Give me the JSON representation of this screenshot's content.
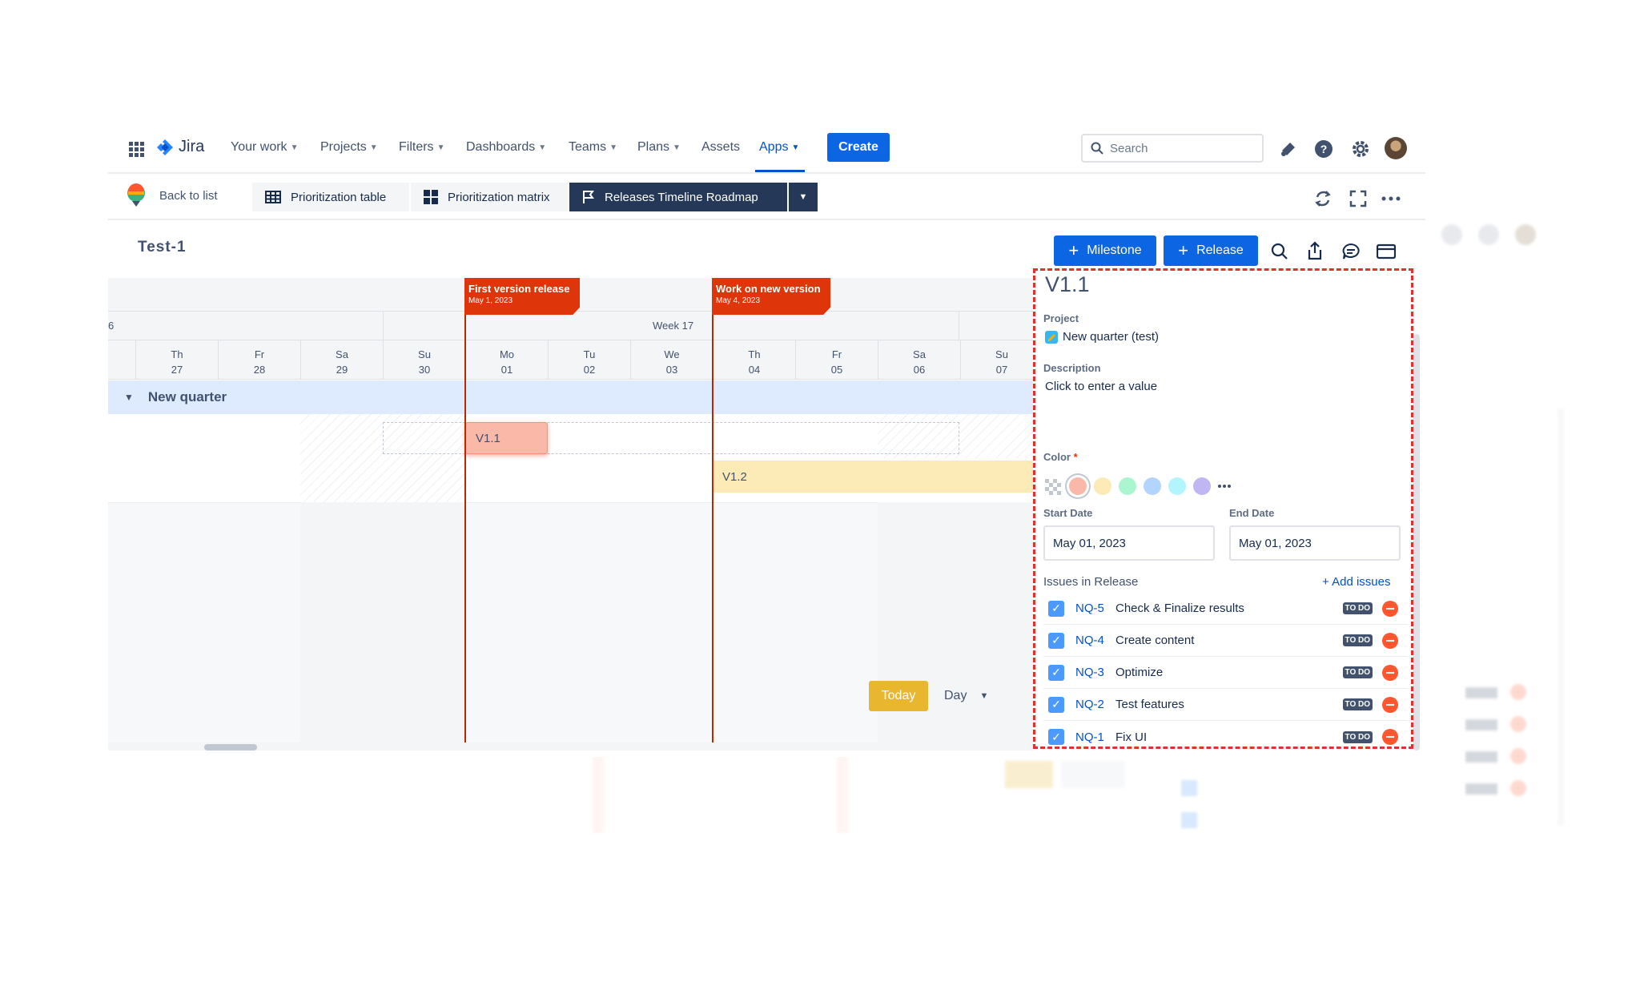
{
  "topnav": {
    "logo": "Jira",
    "items": [
      "Your work",
      "Projects",
      "Filters",
      "Dashboards",
      "Teams",
      "Plans",
      "Assets",
      "Apps"
    ],
    "create": "Create",
    "search_placeholder": "Search"
  },
  "subbar": {
    "back": "Back to list",
    "tabs": [
      "Prioritization table",
      "Prioritization matrix",
      "Releases Timeline Roadmap"
    ]
  },
  "project_title": "Test-1",
  "actions": {
    "milestone": "Milestone",
    "release": "Release"
  },
  "timeline": {
    "week_partial": "6",
    "week_label": "Week 17",
    "days": [
      {
        "d": "Th",
        "n": "27"
      },
      {
        "d": "Fr",
        "n": "28"
      },
      {
        "d": "Sa",
        "n": "29"
      },
      {
        "d": "Su",
        "n": "30"
      },
      {
        "d": "Mo",
        "n": "01"
      },
      {
        "d": "Tu",
        "n": "02"
      },
      {
        "d": "We",
        "n": "03"
      },
      {
        "d": "Th",
        "n": "04"
      },
      {
        "d": "Fr",
        "n": "05"
      },
      {
        "d": "Sa",
        "n": "06"
      },
      {
        "d": "Su",
        "n": "07"
      }
    ],
    "group": "New quarter",
    "milestones": [
      {
        "title": "First version release",
        "date": "May 1, 2023"
      },
      {
        "title": "Work on new version",
        "date": "May 4, 2023"
      }
    ],
    "releases": [
      {
        "name": "V1.1",
        "color": "#f9b8a8"
      },
      {
        "name": "V1.2",
        "color": "#fcebb6"
      }
    ],
    "today": "Today",
    "zoom": "Day"
  },
  "panel": {
    "title": "V1.1",
    "project_label": "Project",
    "project_value": "New quarter (test)",
    "description_label": "Description",
    "description_value": "Click to enter a value",
    "color_label": "Color",
    "color_required": "*",
    "colors": [
      "#f9b8a8",
      "#fcebb6",
      "#abf5d1",
      "#b3d4ff",
      "#b3f5ff",
      "#c0b6f2"
    ],
    "start_label": "Start Date",
    "start_value": "May 01, 2023",
    "end_label": "End Date",
    "end_value": "May 01, 2023",
    "issues_label": "Issues in Release",
    "add_issues": "+ Add issues",
    "issues": [
      {
        "key": "NQ-5",
        "summary": "Check & Finalize results",
        "status": "TO DO"
      },
      {
        "key": "NQ-4",
        "summary": "Create content",
        "status": "TO DO"
      },
      {
        "key": "NQ-3",
        "summary": "Optimize",
        "status": "TO DO"
      },
      {
        "key": "NQ-2",
        "summary": "Test features",
        "status": "TO DO"
      },
      {
        "key": "NQ-1",
        "summary": "Fix UI",
        "status": "TO DO"
      }
    ]
  }
}
